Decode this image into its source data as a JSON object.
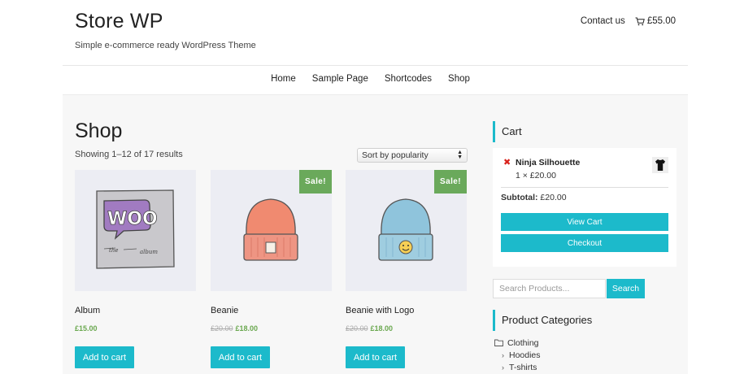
{
  "header": {
    "site_title": "Store WP",
    "tagline": "Simple e-commerce ready WordPress Theme",
    "contact_label": "Contact us",
    "cart_total": "£55.00"
  },
  "nav": {
    "items": [
      {
        "label": "Home"
      },
      {
        "label": "Sample Page"
      },
      {
        "label": "Shortcodes"
      },
      {
        "label": "Shop"
      }
    ]
  },
  "shop": {
    "title": "Shop",
    "result_count": "Showing 1–12 of 17 results",
    "sort_selected": "Sort by popularity",
    "sale_label": "Sale!",
    "add_to_cart_label": "Add to cart",
    "products": [
      {
        "name": "Album",
        "price": "£15.00",
        "old_price": "",
        "on_sale": false
      },
      {
        "name": "Beanie",
        "price": "£18.00",
        "old_price": "£20.00",
        "on_sale": true
      },
      {
        "name": "Beanie with Logo",
        "price": "£18.00",
        "old_price": "£20.00",
        "on_sale": true
      }
    ]
  },
  "sidebar": {
    "cart": {
      "title": "Cart",
      "item_name": "Ninja Silhouette",
      "item_qty": "1 × £20.00",
      "subtotal_label": "Subtotal:",
      "subtotal_value": "£20.00",
      "view_cart_label": "View Cart",
      "checkout_label": "Checkout"
    },
    "search": {
      "placeholder": "Search Products...",
      "button_label": "Search"
    },
    "categories": {
      "title": "Product Categories",
      "items": [
        {
          "label": "Clothing"
        },
        {
          "label": "Hoodies"
        },
        {
          "label": "T-shirts"
        }
      ]
    }
  },
  "colors": {
    "accent": "#1cbacb",
    "sale": "#6aa95b",
    "price": "#6aa84f",
    "remove": "#d9221c"
  }
}
